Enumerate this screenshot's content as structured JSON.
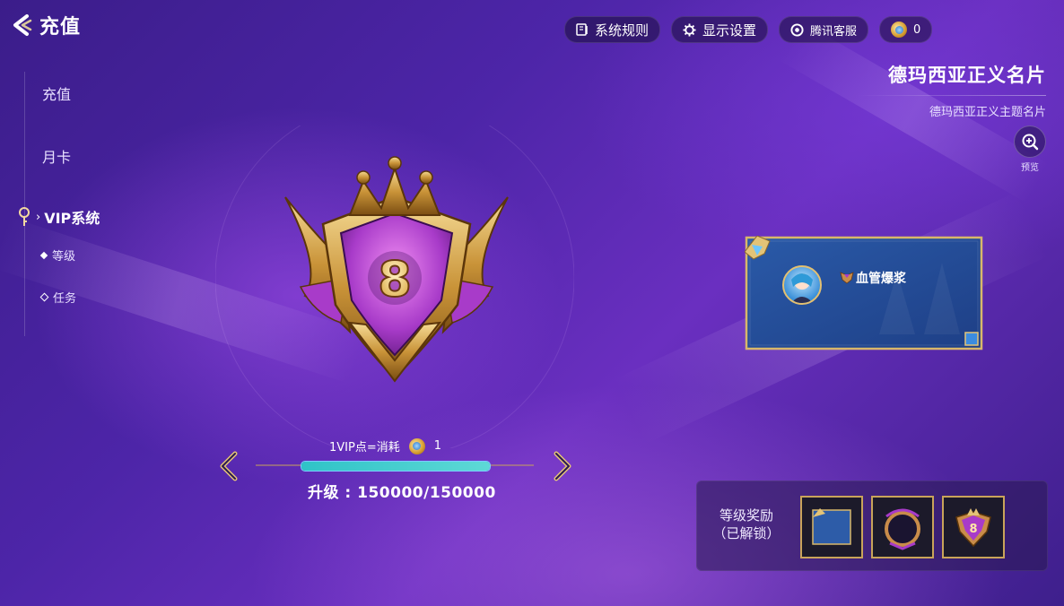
{
  "header": {
    "back_label": "充值"
  },
  "toolbar": {
    "rules": "系统规则",
    "display": "显示设置",
    "service": "腾讯客服",
    "currency_value": "0"
  },
  "sidebar": {
    "items": [
      {
        "label": "充值"
      },
      {
        "label": "月卡"
      }
    ],
    "active_label": "VIP系统",
    "active_marker": "›",
    "sub_items": [
      {
        "label": "等级"
      },
      {
        "label": "任务"
      }
    ]
  },
  "card": {
    "title": "德玛西亚正义名片",
    "subtitle": "德玛西亚正义主题名片",
    "preview_label": "预览",
    "player_name": "血管爆浆"
  },
  "vip": {
    "level": "8",
    "rate_text": "1VIP点=消耗",
    "rate_amount": "1",
    "progress_fraction": 1.0,
    "upgrade_text": "升级 : 150000/150000"
  },
  "rewards": {
    "label_line1": "等级奖励",
    "label_line2": "（已解锁）",
    "badge_level": "8"
  },
  "colors": {
    "accent_gold": "#c9a45a",
    "progress_teal": "#2fc3c7",
    "medal_purple": "#a83bc9"
  }
}
